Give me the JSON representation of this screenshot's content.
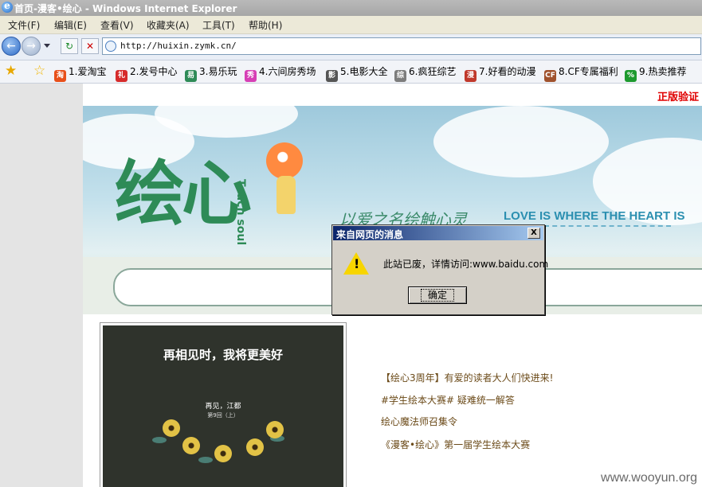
{
  "window": {
    "title": "首页-漫客•绘心 - Windows Internet Explorer"
  },
  "menu": [
    "文件(F)",
    "编辑(E)",
    "查看(V)",
    "收藏夹(A)",
    "工具(T)",
    "帮助(H)"
  ],
  "address": {
    "url": "http://huixin.zymk.cn/"
  },
  "favorites": [
    {
      "label": "1.爱淘宝",
      "icon": "taobao-icon",
      "color": "#e8501a",
      "glyph": "淘"
    },
    {
      "label": "2.发号中心",
      "icon": "gift-icon",
      "color": "#d62b2b",
      "glyph": "礼"
    },
    {
      "label": "3.易乐玩",
      "icon": "globe-icon",
      "color": "#2e8b57",
      "glyph": "易"
    },
    {
      "label": "4.六间房秀场",
      "icon": "show-icon",
      "color": "#d63fb5",
      "glyph": "秀"
    },
    {
      "label": "5.电影大全",
      "icon": "film-reel-icon",
      "color": "#555555",
      "glyph": "影"
    },
    {
      "label": "6.疯狂综艺",
      "icon": "tv-icon",
      "color": "#7d7d7d",
      "glyph": "综"
    },
    {
      "label": "7.好看的动漫",
      "icon": "book-icon",
      "color": "#c0392b",
      "glyph": "漫"
    },
    {
      "label": "8.CF专属福利",
      "icon": "cf-icon",
      "color": "#a0522d",
      "glyph": "CF"
    },
    {
      "label": "9.热卖推荐",
      "icon": "percent-icon",
      "color": "#1d9a2e",
      "glyph": "%"
    }
  ],
  "page": {
    "auth_link": "正版验证",
    "logo_text": "绘心",
    "logo_side": "Touch soul",
    "slogan_cn": "以爱之名绘触心灵",
    "slogan_en": "LOVE IS WHERE THE HEART IS",
    "cover": {
      "title": "再相见时，我将更美好",
      "subtitle": "再见，江都",
      "subtitle2": "第9回（上）"
    },
    "news": [
      "【绘心3周年】有爱的读者大人们快进来!",
      "#学生绘本大赛# 疑难统一解答",
      "绘心魔法师召集令",
      "《漫客•绘心》第一届学生绘本大赛"
    ]
  },
  "dialog": {
    "title": "来自网页的消息",
    "message": "此站已废，详情访问:www.baidu.com",
    "ok_label": "确定",
    "close_glyph": "X"
  },
  "watermark": "www.wooyun.org"
}
